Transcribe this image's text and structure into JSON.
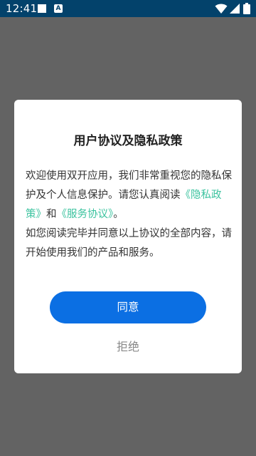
{
  "status_bar": {
    "time": "12:41",
    "notification_icons": [
      "square-notification-icon",
      "a-notification-icon"
    ],
    "system_icons": [
      "wifi-icon",
      "cellular-signal-icon",
      "battery-icon"
    ]
  },
  "dialog": {
    "title": "用户协议及隐私政策",
    "body": {
      "intro": "欢迎使用双开应用，我们非常重视您的隐私保护及个人信息保护。请您认真阅读",
      "privacy_link": "《隐私政策》",
      "conjunction": "和",
      "service_link": "《服务协议》",
      "period": "。",
      "second_paragraph": "如您阅读完毕并同意以上协议的全部内容，请开始使用我们的产品和服务。"
    },
    "agree_label": "同意",
    "reject_label": "拒绝"
  },
  "colors": {
    "status_bar": "#03426b",
    "overlay": "#636363",
    "link": "#3cc39f",
    "primary_button": "#0b6fe3",
    "secondary_text": "#888888"
  }
}
